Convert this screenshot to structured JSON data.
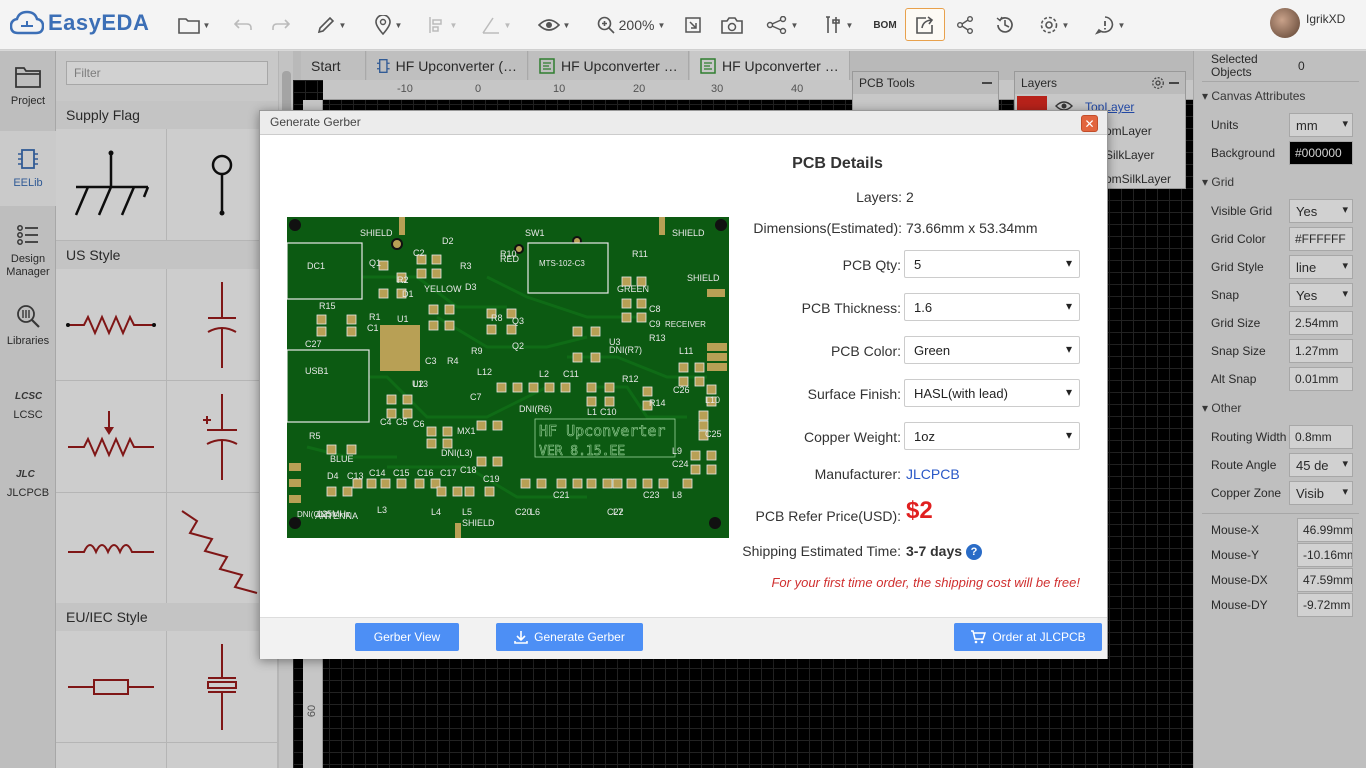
{
  "app": {
    "name": "EasyEDA",
    "zoom": "200%",
    "bom_label": "BOM",
    "username": "IgrikXD"
  },
  "leftnav": [
    {
      "label": "Project",
      "icon": "folder-icon"
    },
    {
      "label": "EELib",
      "icon": "chip-icon"
    },
    {
      "label": "Design Manager",
      "icon": "list-icon"
    },
    {
      "label": "Libraries",
      "icon": "search-library-icon"
    },
    {
      "label": "LCSC",
      "icon": "lcsc-logo-icon"
    },
    {
      "label": "JLCPCB",
      "icon": "jlcpcb-logo-icon"
    }
  ],
  "library": {
    "filter_placeholder": "Filter",
    "sections": [
      "Supply Flag",
      "US Style",
      "EU/IEC Style"
    ]
  },
  "tabs": [
    {
      "label": "Start"
    },
    {
      "label": "HF Upconverter (…"
    },
    {
      "label": "HF Upconverter …"
    },
    {
      "label": "HF Upconverter …"
    }
  ],
  "ruler": {
    "ticks": [
      "-10",
      "0",
      "10",
      "20",
      "30",
      "40"
    ],
    "vertical_tick": "60"
  },
  "pcb_tools": {
    "title": "PCB Tools"
  },
  "layers": {
    "title": "Layers",
    "items": [
      "TopLayer",
      "omLayer",
      "SilkLayer",
      "omSilkLayer"
    ]
  },
  "right_panel": {
    "selected_label": "Selected Objects",
    "selected_count": "0",
    "canvas_attr": "Canvas Attributes",
    "units_label": "Units",
    "units_value": "mm",
    "background_label": "Background",
    "background_value": "#000000",
    "grid_section": "Grid",
    "visible_grid_label": "Visible Grid",
    "visible_grid_value": "Yes",
    "grid_color_label": "Grid Color",
    "grid_color_value": "#FFFFFF",
    "grid_style_label": "Grid Style",
    "grid_style_value": "line",
    "snap_label": "Snap",
    "snap_value": "Yes",
    "grid_size_label": "Grid Size",
    "grid_size_value": "2.54mm",
    "snap_size_label": "Snap Size",
    "snap_size_value": "1.27mm",
    "alt_snap_label": "Alt Snap",
    "alt_snap_value": "0.01mm",
    "other_section": "Other",
    "routing_width_label": "Routing Width",
    "routing_width_value": "0.8mm",
    "route_angle_label": "Route Angle",
    "route_angle_value": "45 de",
    "copper_zone_label": "Copper Zone",
    "copper_zone_value": "Visib",
    "mouse_x_label": "Mouse-X",
    "mouse_x_value": "46.99mm",
    "mouse_y_label": "Mouse-Y",
    "mouse_y_value": "-10.16mm",
    "mouse_dx_label": "Mouse-DX",
    "mouse_dx_value": "47.59mm",
    "mouse_dy_label": "Mouse-DY",
    "mouse_dy_value": "-9.72mm"
  },
  "modal": {
    "title": "Generate Gerber",
    "details_title": "PCB Details",
    "layers_label": "Layers:",
    "layers_value": "2",
    "dimensions_label": "Dimensions(Estimated):",
    "dimensions_value": "73.66mm x 53.34mm",
    "qty_label": "PCB Qty:",
    "qty_value": "5",
    "thickness_label": "PCB Thickness:",
    "thickness_value": "1.6",
    "color_label": "PCB Color:",
    "color_value": "Green",
    "finish_label": "Surface Finish:",
    "finish_value": "HASL(with lead)",
    "copper_label": "Copper Weight:",
    "copper_value": "1oz",
    "manufacturer_label": "Manufacturer:",
    "manufacturer_value": "JLCPCB",
    "price_label": "PCB Refer Price(USD):",
    "price_value": "$2",
    "shipping_label": "Shipping Estimated Time:",
    "shipping_value": "3-7 days",
    "note": "For your first time order, the shipping cost will be free!",
    "btn_gerber_view": "Gerber View",
    "btn_generate": "Generate Gerber",
    "btn_order": "Order at JLCPCB"
  },
  "pcb_preview": {
    "board_title": "HF Upconverter",
    "board_version": "VER 8.15.EE",
    "labels": [
      "SHIELD",
      "SHIELD",
      "SHIELD",
      "SHIELD",
      "DC1",
      "USB1",
      "ANTENNA",
      "BLUE",
      "YELLOW",
      "RED",
      "GREEN",
      "RECEIVER",
      "MTS-102-C3",
      "SW1",
      "Q1",
      "Q2",
      "Q3",
      "U1",
      "U2",
      "U3",
      "D1",
      "D2",
      "D3",
      "D4",
      "MX1",
      "R1",
      "R2",
      "R3",
      "R4",
      "R5",
      "R8",
      "R9",
      "R10",
      "R11",
      "R12",
      "R13",
      "R14",
      "R15",
      "C1",
      "C2",
      "C3",
      "C4",
      "C5",
      "C6",
      "C7",
      "C8",
      "C9",
      "C10",
      "C11",
      "C13",
      "C14",
      "C15",
      "C16",
      "C17",
      "C18",
      "C19",
      "C20",
      "C21",
      "C22",
      "C23",
      "C24",
      "C25",
      "C26",
      "C27",
      "L1",
      "L2",
      "L3",
      "L4",
      "L5",
      "L6",
      "L7",
      "L8",
      "L9",
      "L10",
      "L11",
      "L12",
      "L13",
      "DNI(L3)",
      "DNI(R6)",
      "DNI(R7)",
      "DNI(C12)",
      "125MHz"
    ],
    "colors": {
      "board": "#0c5a12",
      "silk": "#e8e8e8",
      "pad": "#b8a055",
      "trace": "#0f6b16"
    }
  },
  "colors": {
    "accent": "#4d8ff5",
    "brand": "#3c6fb6",
    "price": "#e02020",
    "note": "#d03030",
    "close": "#e2653e"
  }
}
